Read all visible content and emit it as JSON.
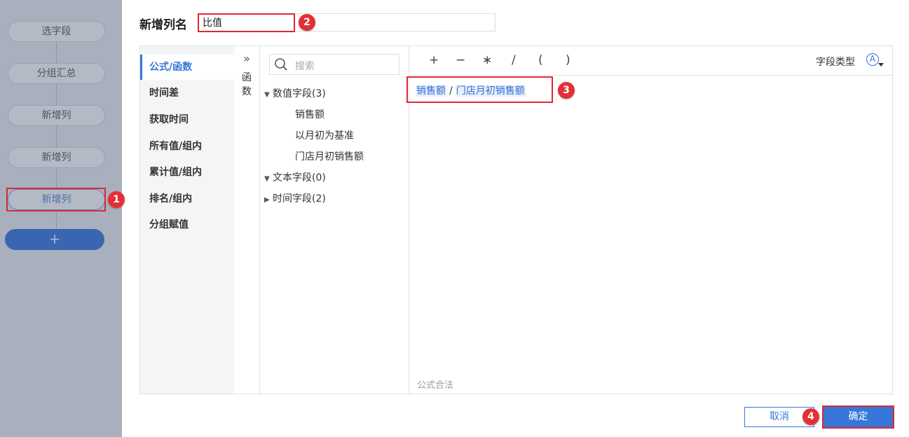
{
  "steps": [
    "选字段",
    "分组汇总",
    "新增列",
    "新增列",
    "新增列"
  ],
  "add_step_label": "+",
  "header": {
    "title": "新增列名",
    "name_value": "比值"
  },
  "categories": [
    "公式/函数",
    "时间差",
    "获取时间",
    "所有值/组内",
    "累计值/组内",
    "排名/组内",
    "分组赋值"
  ],
  "collapse": {
    "arrow": "»",
    "label_1": "函",
    "label_2": "数"
  },
  "search": {
    "placeholder": "搜索"
  },
  "field_groups": [
    {
      "label": "数值字段(3)",
      "expanded": true,
      "fields": [
        "销售额",
        "以月初为基准",
        "门店月初销售额"
      ]
    },
    {
      "label": "文本字段(0)",
      "expanded": true,
      "fields": []
    },
    {
      "label": "时间字段(2)",
      "expanded": false,
      "fields": []
    }
  ],
  "operators": [
    "+",
    "−",
    "∗",
    "/",
    "(",
    ")"
  ],
  "field_type_label": "字段类型",
  "field_type_icon": "A",
  "formula": {
    "token_1": "销售额",
    "operator": "/",
    "token_2": "门店月初销售额"
  },
  "status": "公式合法",
  "buttons": {
    "cancel": "取消",
    "confirm": "确定"
  },
  "badges": [
    "1",
    "2",
    "3",
    "4"
  ],
  "colors": {
    "accent": "#3677d9",
    "highlight": "#e0282e"
  }
}
